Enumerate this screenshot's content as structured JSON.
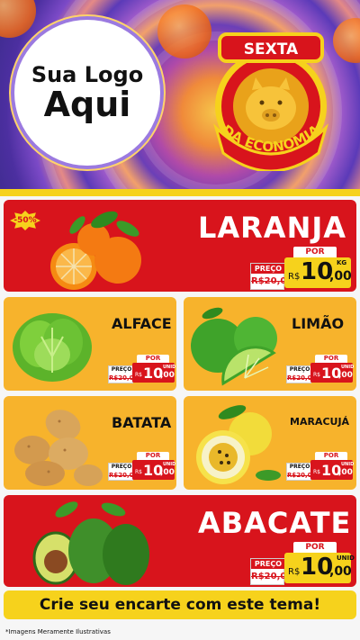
{
  "header": {
    "logo_line1": "Sua Logo",
    "logo_line2": "Aqui",
    "badge_top": "SEXTA",
    "badge_bottom": "DA ECONOMIA"
  },
  "products": [
    {
      "name": "LARANJA",
      "preco_label": "PREÇO",
      "old_price": "R$20,00",
      "por_label": "POR",
      "currency": "R$",
      "price_int": "10",
      "price_dec": ",00",
      "unit": "KG",
      "discount": "-50%"
    },
    {
      "name": "ALFACE",
      "preco_label": "PREÇO",
      "old_price": "R$20,00",
      "por_label": "POR",
      "currency": "R$",
      "price_int": "10",
      "price_dec": ",00",
      "unit": "UNID"
    },
    {
      "name": "LIMÃO",
      "preco_label": "PREÇO",
      "old_price": "R$20,00",
      "por_label": "POR",
      "currency": "R$",
      "price_int": "10",
      "price_dec": ",00",
      "unit": "UNID"
    },
    {
      "name": "BATATA",
      "preco_label": "PREÇO",
      "old_price": "R$20,00",
      "por_label": "POR",
      "currency": "R$",
      "price_int": "10",
      "price_dec": ",00",
      "unit": "UNID"
    },
    {
      "name": "MARACUJÁ",
      "preco_label": "PREÇO",
      "old_price": "R$20,00",
      "por_label": "POR",
      "currency": "R$",
      "price_int": "10",
      "price_dec": ",00",
      "unit": "UNID"
    },
    {
      "name": "ABACATE",
      "preco_label": "PREÇO",
      "old_price": "R$20,00",
      "por_label": "POR",
      "currency": "R$",
      "price_int": "10",
      "price_dec": ",00",
      "unit": "UNID"
    }
  ],
  "cta": "Crie seu encarte com este tema!",
  "footer": "*Imagens Meramente Ilustrativas",
  "colors": {
    "red": "#d8141c",
    "yellow": "#f6d21c",
    "orange": "#f7b32c",
    "purple": "#6b3fb7"
  }
}
